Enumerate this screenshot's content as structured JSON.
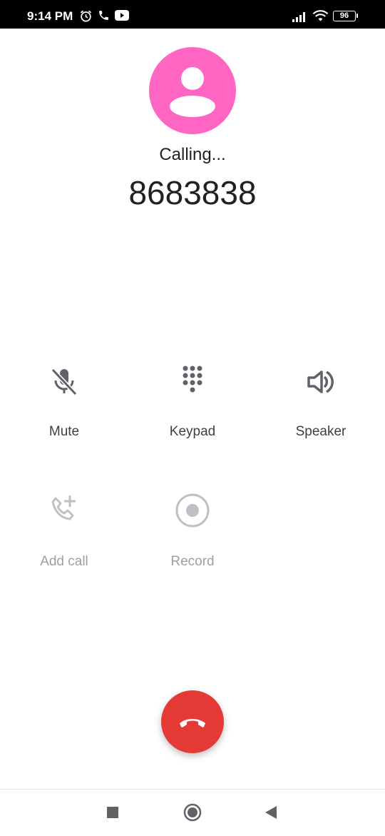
{
  "status_bar": {
    "time": "9:14 PM",
    "battery_level": "96",
    "icons": [
      "alarm-icon",
      "phone-icon",
      "youtube-icon",
      "signal-icon",
      "wifi-icon",
      "battery-icon"
    ]
  },
  "call": {
    "status": "Calling...",
    "number": "8683838",
    "avatar_color": "#ff66c4"
  },
  "controls": [
    {
      "label": "Mute",
      "icon": "mic-off-icon",
      "enabled": true
    },
    {
      "label": "Keypad",
      "icon": "dialpad-icon",
      "enabled": true
    },
    {
      "label": "Speaker",
      "icon": "speaker-icon",
      "enabled": true
    },
    {
      "label": "Add call",
      "icon": "add-call-icon",
      "enabled": false
    },
    {
      "label": "Record",
      "icon": "record-icon",
      "enabled": false
    }
  ],
  "end_call": {
    "icon": "call-end-icon",
    "color": "#e53935"
  },
  "nav_bar": {
    "icons": [
      "recents-icon",
      "home-icon",
      "back-icon"
    ]
  }
}
